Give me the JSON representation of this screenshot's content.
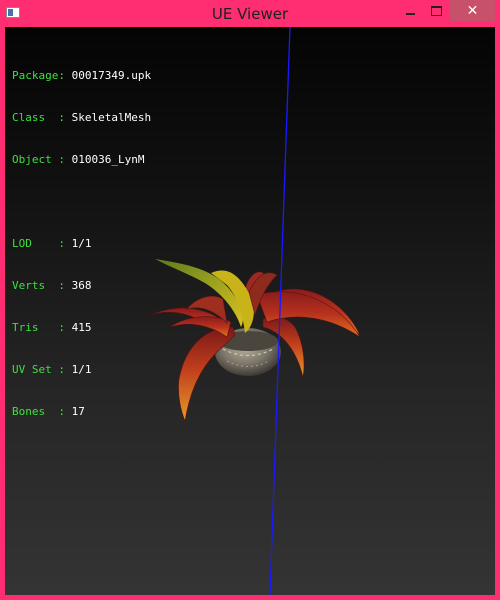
{
  "window": {
    "title": "UE Viewer"
  },
  "titlebar_buttons": {
    "minimize_icon": "minimize-icon",
    "maximize_icon": "maximize-icon",
    "close_glyph": "✕"
  },
  "mesh_info": {
    "package": {
      "label": "Package:",
      "value": "00017349.upk"
    },
    "class": {
      "label": "Class  :",
      "value": "SkeletalMesh"
    },
    "object": {
      "label": "Object :",
      "value": "010036_LynM"
    },
    "lod": {
      "label": "LOD    :",
      "value": "1/1"
    },
    "verts": {
      "label": "Verts  :",
      "value": "368"
    },
    "tris": {
      "label": "Tris   :",
      "value": "415"
    },
    "uvset": {
      "label": "UV Set :",
      "value": "1/1"
    },
    "bones": {
      "label": "Bones  :",
      "value": "17"
    }
  },
  "colors": {
    "frame": "#ff2d72",
    "info_label": "#3fe03f",
    "info_value": "#ffffff",
    "axis_line": "#1a1aff"
  }
}
